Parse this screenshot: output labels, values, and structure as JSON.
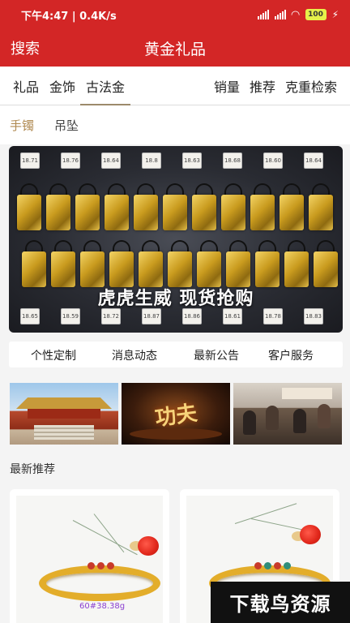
{
  "status_bar": {
    "time_speed": "下午4:47 | 0.4K/s",
    "battery": "100"
  },
  "nav": {
    "search_label": "搜索",
    "title": "黄金礼品"
  },
  "tabs": {
    "left": [
      "礼品",
      "金饰",
      "古法金"
    ],
    "right": [
      "销量",
      "推荐",
      "克重检索"
    ],
    "active": "古法金"
  },
  "subtabs": {
    "items": [
      "手镯",
      "吊坠"
    ],
    "active": "手镯"
  },
  "banner": {
    "caption": "虎虎生威 现货抢购",
    "tags": [
      "18.71",
      "18.76",
      "18.64",
      "18.8",
      "18.63",
      "18.68",
      "18.60",
      "18.64",
      "18.65",
      "18.59",
      "18.72",
      "18.87",
      "18.86",
      "18.61",
      "18.78",
      "18.83"
    ]
  },
  "quick_links": [
    "个性定制",
    "消息动态",
    "最新公告",
    "客户服务"
  ],
  "thumbs": {
    "kungfu_text": "功夫"
  },
  "recommend": {
    "title": "最新推荐",
    "products": [
      {
        "price": "60#38.38g"
      },
      {
        "price": ""
      }
    ]
  },
  "watermark": "下载鸟资源"
}
